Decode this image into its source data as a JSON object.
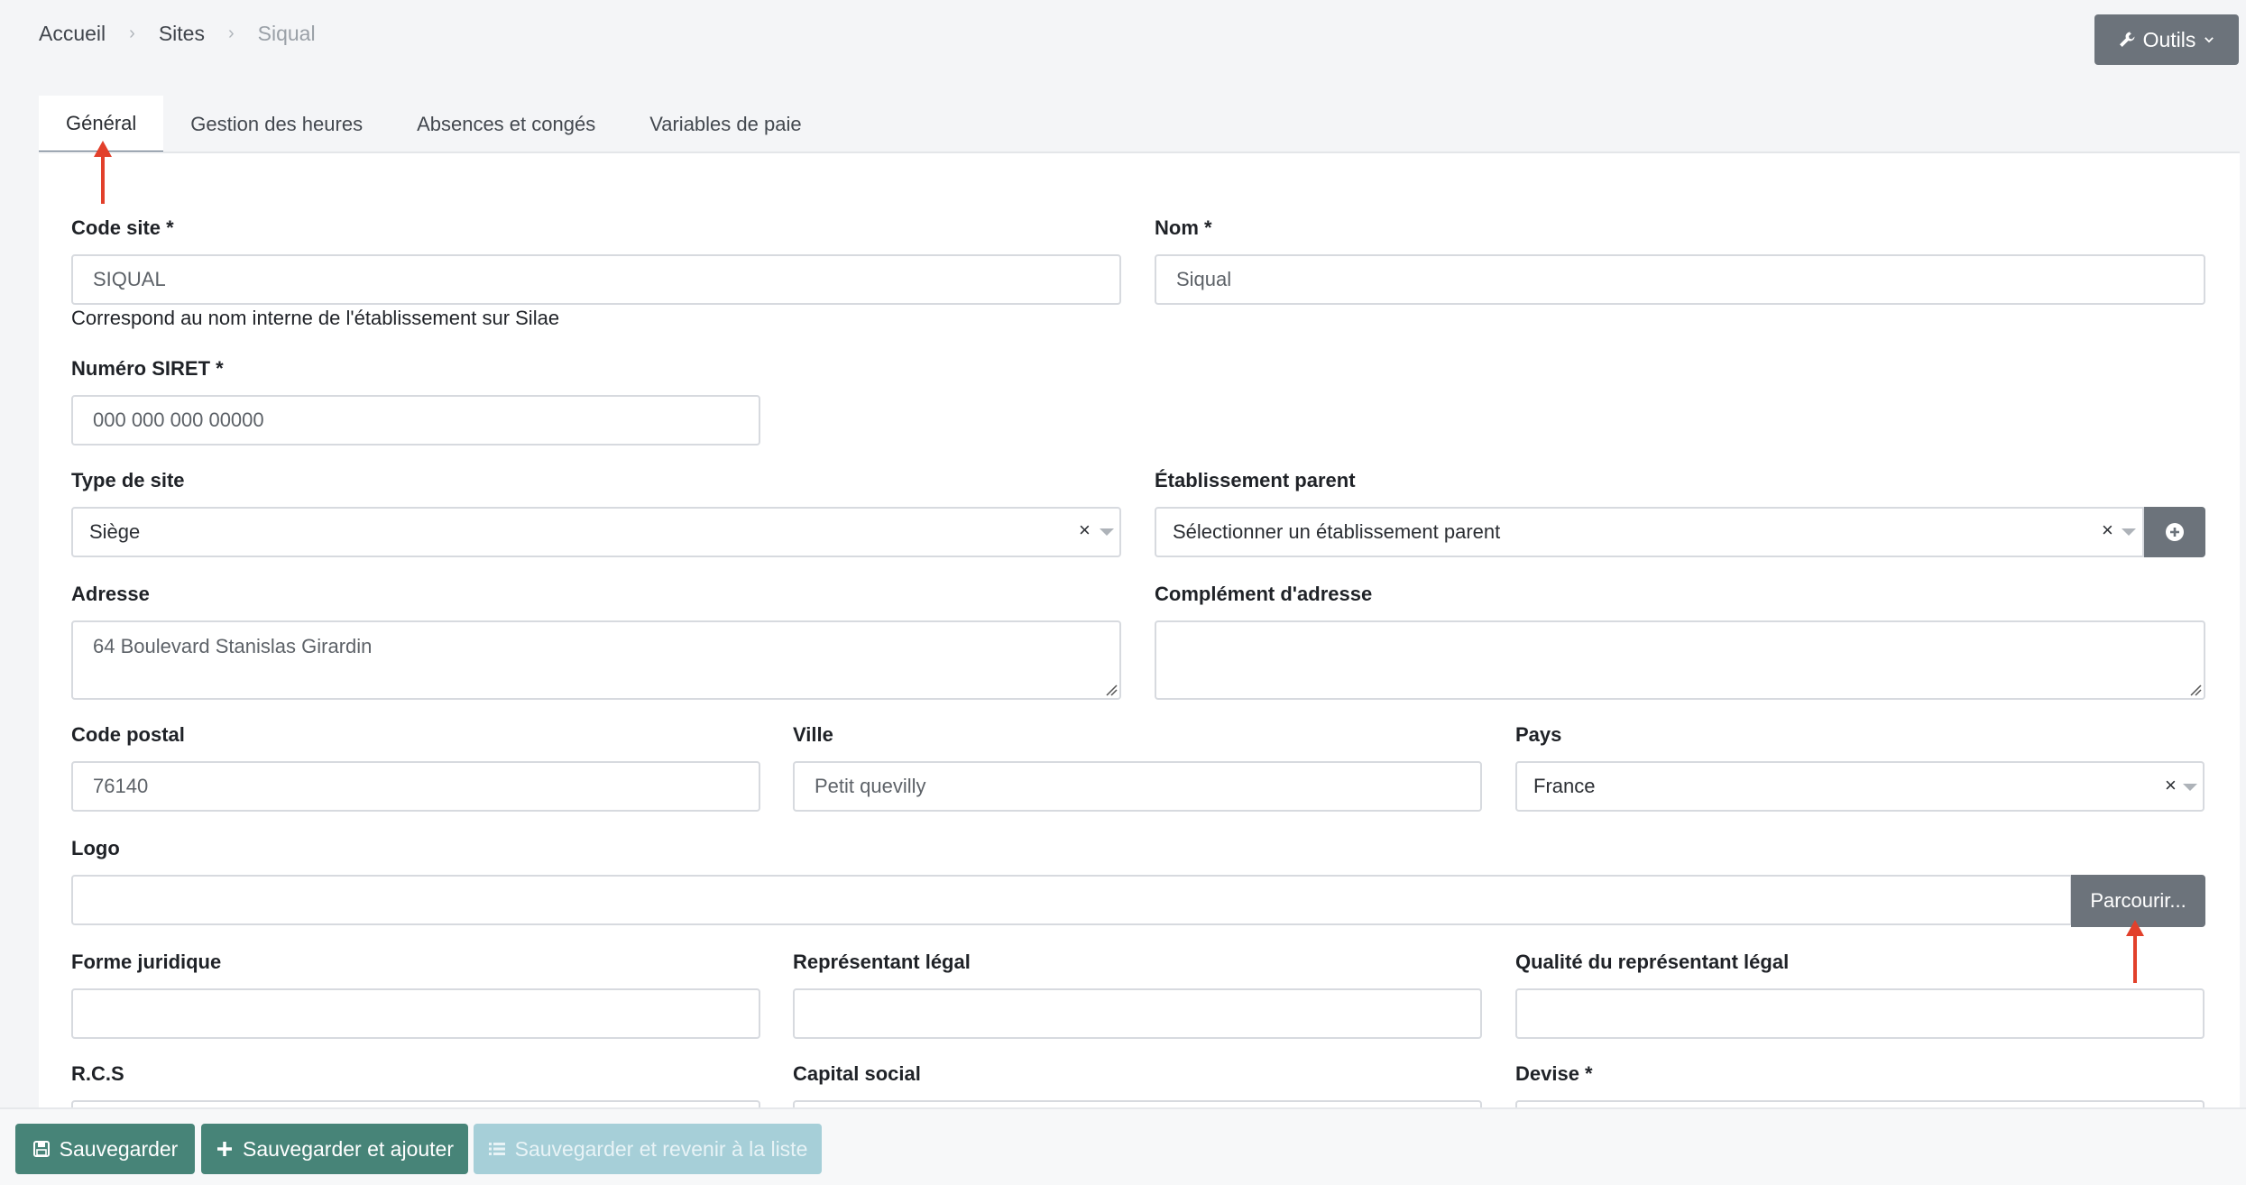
{
  "breadcrumb": {
    "items": [
      "Accueil",
      "Sites",
      "Siqual"
    ],
    "separator": "›"
  },
  "tools_button": {
    "label": "Outils"
  },
  "tabs": [
    {
      "label": "Général",
      "active": true
    },
    {
      "label": "Gestion des heures",
      "active": false
    },
    {
      "label": "Absences et congés",
      "active": false
    },
    {
      "label": "Variables de paie",
      "active": false
    }
  ],
  "form": {
    "code_site": {
      "label": "Code site *",
      "value": "SIQUAL",
      "help": "Correspond au nom interne de l'établissement sur Silae"
    },
    "nom": {
      "label": "Nom *",
      "value": "Siqual"
    },
    "siret": {
      "label": "Numéro SIRET *",
      "placeholder": "000 000 000 00000"
    },
    "type_site": {
      "label": "Type de site",
      "value": "Siège",
      "clear": "×"
    },
    "etab_parent": {
      "label": "Établissement parent",
      "placeholder": "Sélectionner un établissement parent",
      "clear": "×"
    },
    "adresse": {
      "label": "Adresse",
      "value": "64 Boulevard Stanislas Girardin"
    },
    "complement": {
      "label": "Complément d'adresse",
      "value": ""
    },
    "code_postal": {
      "label": "Code postal",
      "value": "76140"
    },
    "ville": {
      "label": "Ville",
      "value": "Petit quevilly"
    },
    "pays": {
      "label": "Pays",
      "value": "France",
      "clear": "×"
    },
    "logo": {
      "label": "Logo",
      "browse_label": "Parcourir..."
    },
    "forme_juridique": {
      "label": "Forme juridique",
      "value": ""
    },
    "representant": {
      "label": "Représentant légal",
      "value": ""
    },
    "qualite_representant": {
      "label": "Qualité du représentant légal",
      "value": ""
    },
    "rcs": {
      "label": "R.C.S"
    },
    "capital": {
      "label": "Capital social"
    },
    "devise": {
      "label": "Devise *"
    }
  },
  "actions": {
    "save": "Sauvegarder",
    "save_add": "Sauvegarder et ajouter",
    "save_return": "Sauvegarder et revenir à la liste"
  },
  "colors": {
    "primary": "#478478",
    "secondary": "#6c737b",
    "disabled": "#a6cfd8",
    "annotation_arrow": "#e2402b"
  }
}
